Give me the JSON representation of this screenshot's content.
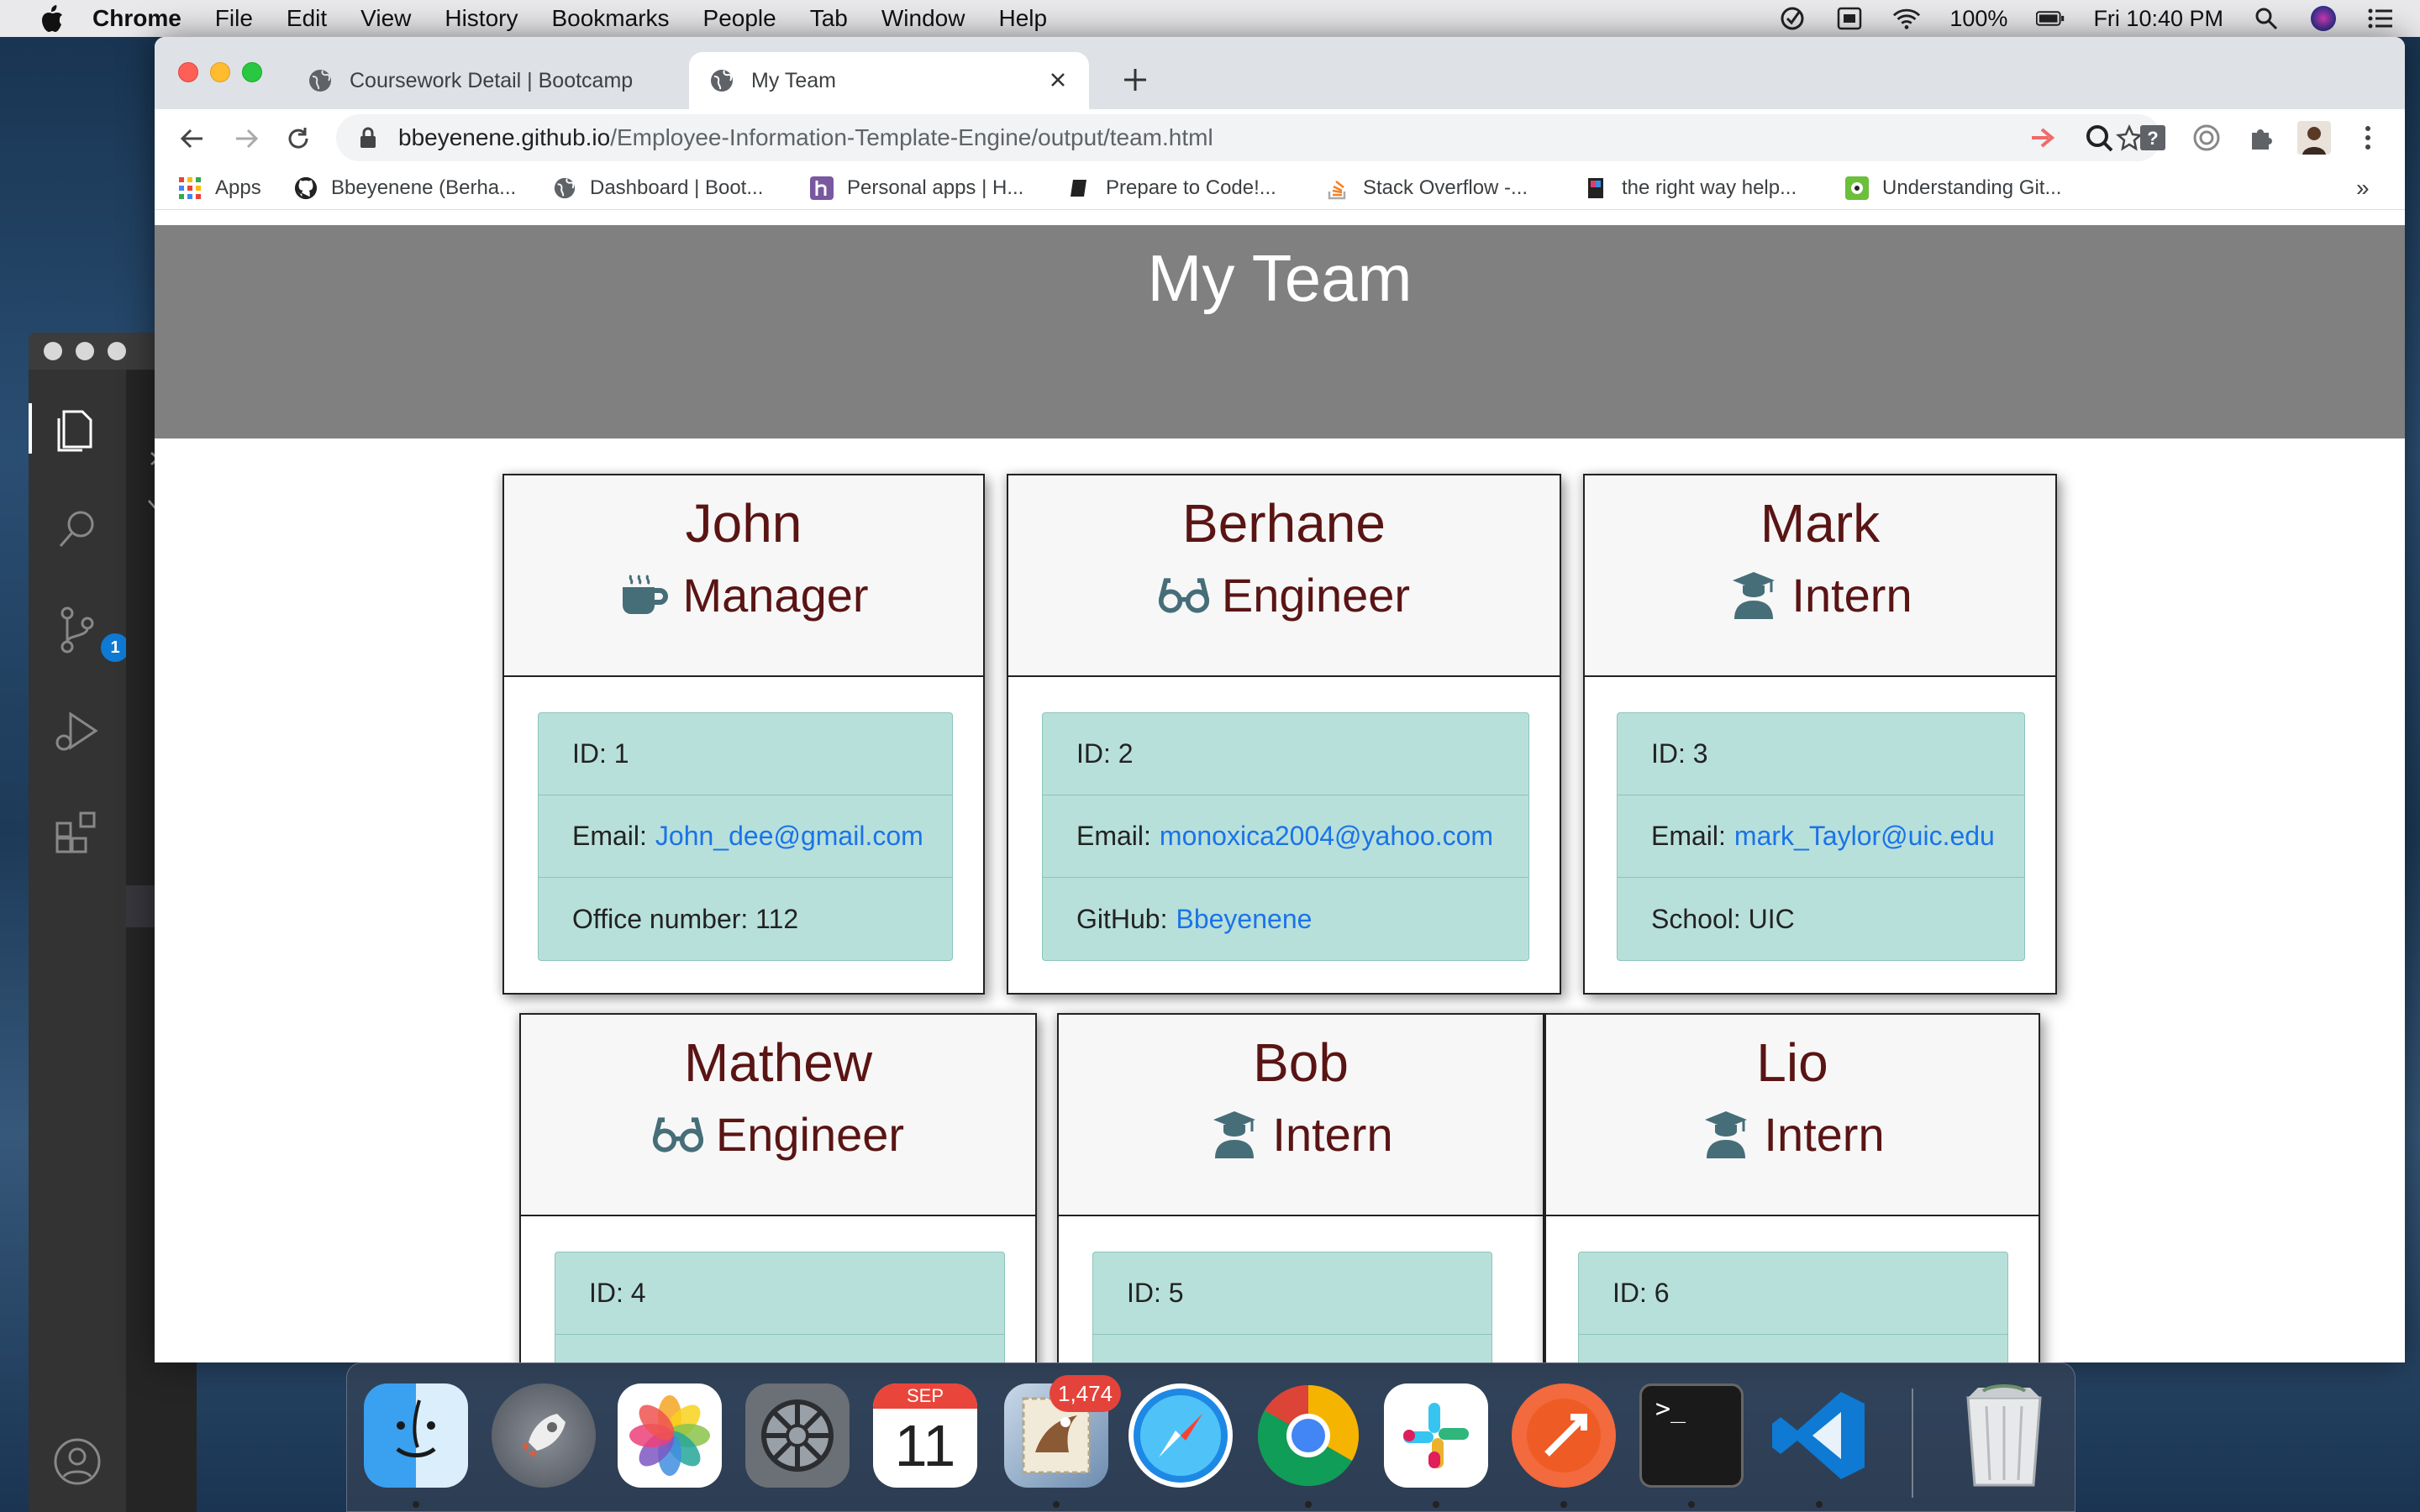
{
  "menubar": {
    "app_name": "Chrome",
    "items": [
      "File",
      "Edit",
      "View",
      "History",
      "Bookmarks",
      "People",
      "Tab",
      "Window",
      "Help"
    ],
    "battery": "100%",
    "clock": "Fri 10:40 PM"
  },
  "vscode": {
    "scm_badge": "1"
  },
  "tabs": [
    {
      "title": "Coursework Detail | Bootcamp",
      "active": false
    },
    {
      "title": "My Team",
      "active": true
    }
  ],
  "address": {
    "host": "bbeyenene.github.io",
    "path": "/Employee-Information-Template-Engine/output/team.html"
  },
  "bookmarks": [
    {
      "label": "Apps",
      "icon": "apps-grid-icon"
    },
    {
      "label": "Bbeyenene (Berha...",
      "icon": "github-icon"
    },
    {
      "label": "Dashboard | Boot...",
      "icon": "globe-icon"
    },
    {
      "label": "Personal apps | H...",
      "icon": "heroku-icon"
    },
    {
      "label": "Prepare to Code!...",
      "icon": "book-icon"
    },
    {
      "label": "Stack Overflow -...",
      "icon": "stackoverflow-icon"
    },
    {
      "label": "the right way help...",
      "icon": "bookmark-icon"
    },
    {
      "label": "Understanding Git...",
      "icon": "git-icon"
    }
  ],
  "bookmarks_overflow": "»",
  "page": {
    "heading": "My Team",
    "employees": [
      {
        "name": "John",
        "role": "Manager",
        "role_icon": "coffee-mug-icon",
        "id_label": "ID: 1",
        "email_label": "Email:",
        "email": "John_dee@gmail.com",
        "extra_label": "Office number: 112",
        "extra_link": ""
      },
      {
        "name": "Berhane",
        "role": "Engineer",
        "role_icon": "glasses-icon",
        "id_label": "ID: 2",
        "email_label": "Email:",
        "email": "monoxica2004@yahoo.com",
        "extra_label": "GitHub:",
        "extra_link": "Bbeyenene"
      },
      {
        "name": "Mark",
        "role": "Intern",
        "role_icon": "graduate-icon",
        "id_label": "ID: 3",
        "email_label": "Email:",
        "email": "mark_Taylor@uic.edu",
        "extra_label": "School: UIC",
        "extra_link": ""
      },
      {
        "name": "Mathew",
        "role": "Engineer",
        "role_icon": "glasses-icon",
        "id_label": "ID: 4"
      },
      {
        "name": "Bob",
        "role": "Intern",
        "role_icon": "graduate-icon",
        "id_label": "ID: 5"
      },
      {
        "name": "Lio",
        "role": "Intern",
        "role_icon": "graduate-icon",
        "id_label": "ID: 6"
      }
    ]
  },
  "dock": {
    "mail_badge": "1,474",
    "calendar_month": "SEP",
    "calendar_day": "11",
    "terminal_prompt": ">_"
  },
  "colors": {
    "card_title": "#5a1414",
    "list_bg": "#b8e0da",
    "link": "#1a73e8",
    "jumbotron": "#808080"
  }
}
